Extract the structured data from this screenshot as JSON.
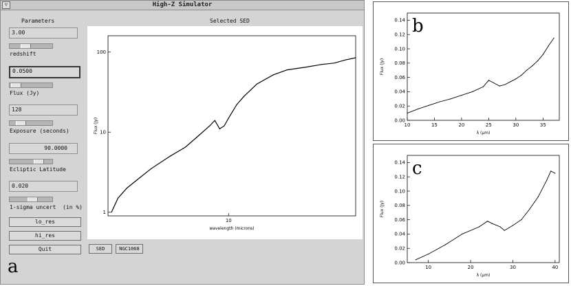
{
  "window": {
    "title": "High-Z Simulator",
    "menu_glyph": "▽"
  },
  "left": {
    "header": "Parameters",
    "redshift": {
      "value": "3.00",
      "label": "redshift",
      "slider_pos": 0.35
    },
    "flux": {
      "value": "0.0500",
      "label": "Flux (Jy)",
      "slider_pos": 0.05
    },
    "exposure": {
      "value": "128",
      "label": "Exposure (seconds)",
      "slider_pos": 0.2
    },
    "latitude": {
      "value": "90.0000",
      "label": "Ecliptic Latitude",
      "slider_pos": 0.75
    },
    "uncert": {
      "value": "0.020",
      "label": "1-sigma uncert  (in %)",
      "slider_pos": 0.55
    },
    "buttons": {
      "lo_res": "lo_res",
      "hi_res": "hi_res",
      "quit": "Quit"
    }
  },
  "center": {
    "header": "Selected SED",
    "sed_button": "SED",
    "sed_name": "NGC1068"
  },
  "panel_labels": {
    "a": "a",
    "b": "b",
    "c": "c"
  },
  "chart_data": [
    {
      "id": "main",
      "type": "line",
      "xlabel": "wavelength (microns)",
      "ylabel": "Flux (Jy)",
      "xscale": "log",
      "yscale": "log",
      "xlim": [
        2.4,
        45
      ],
      "ylim": [
        0.9,
        160
      ],
      "x_ticks": [
        10
      ],
      "y_ticks": [
        1,
        10,
        100
      ],
      "x": [
        2.5,
        2.7,
        3,
        3.5,
        4,
        5,
        6,
        7,
        8,
        8.5,
        9,
        9.5,
        10,
        11,
        12,
        14,
        17,
        20,
        25,
        30,
        35,
        40,
        45
      ],
      "y": [
        1.0,
        1.5,
        2.0,
        2.7,
        3.5,
        5,
        6.5,
        9,
        12,
        14,
        11,
        12,
        15,
        22,
        28,
        40,
        52,
        60,
        65,
        70,
        73,
        80,
        85
      ]
    },
    {
      "id": "b",
      "type": "line",
      "xlabel": "λ (μm)",
      "ylabel": "Flux (Jy)",
      "xlim": [
        10,
        38
      ],
      "ylim": [
        0,
        0.15
      ],
      "x_ticks": [
        10,
        15,
        20,
        25,
        30,
        35
      ],
      "y_ticks": [
        0.0,
        0.02,
        0.04,
        0.06,
        0.08,
        0.1,
        0.12,
        0.14
      ],
      "x": [
        10,
        12,
        14,
        16,
        18,
        20,
        22,
        24,
        25,
        26,
        27,
        28,
        29,
        30,
        31,
        32,
        33,
        34,
        35,
        36,
        37
      ],
      "y": [
        0.01,
        0.016,
        0.021,
        0.026,
        0.03,
        0.035,
        0.04,
        0.047,
        0.056,
        0.052,
        0.048,
        0.05,
        0.054,
        0.058,
        0.063,
        0.07,
        0.076,
        0.083,
        0.092,
        0.104,
        0.115
      ]
    },
    {
      "id": "c",
      "type": "line",
      "xlabel": "λ (μm)",
      "ylabel": "Flux (Jy)",
      "xlim": [
        5,
        41
      ],
      "ylim": [
        0,
        0.15
      ],
      "x_ticks": [
        10,
        20,
        30,
        40
      ],
      "y_ticks": [
        0.0,
        0.02,
        0.04,
        0.06,
        0.08,
        0.1,
        0.12,
        0.14
      ],
      "x": [
        7,
        10,
        14,
        18,
        22,
        24,
        25,
        27,
        28,
        30,
        32,
        34,
        36,
        38,
        39,
        40
      ],
      "y": [
        0.004,
        0.012,
        0.025,
        0.04,
        0.05,
        0.058,
        0.055,
        0.05,
        0.045,
        0.052,
        0.06,
        0.075,
        0.092,
        0.115,
        0.128,
        0.125
      ]
    }
  ]
}
